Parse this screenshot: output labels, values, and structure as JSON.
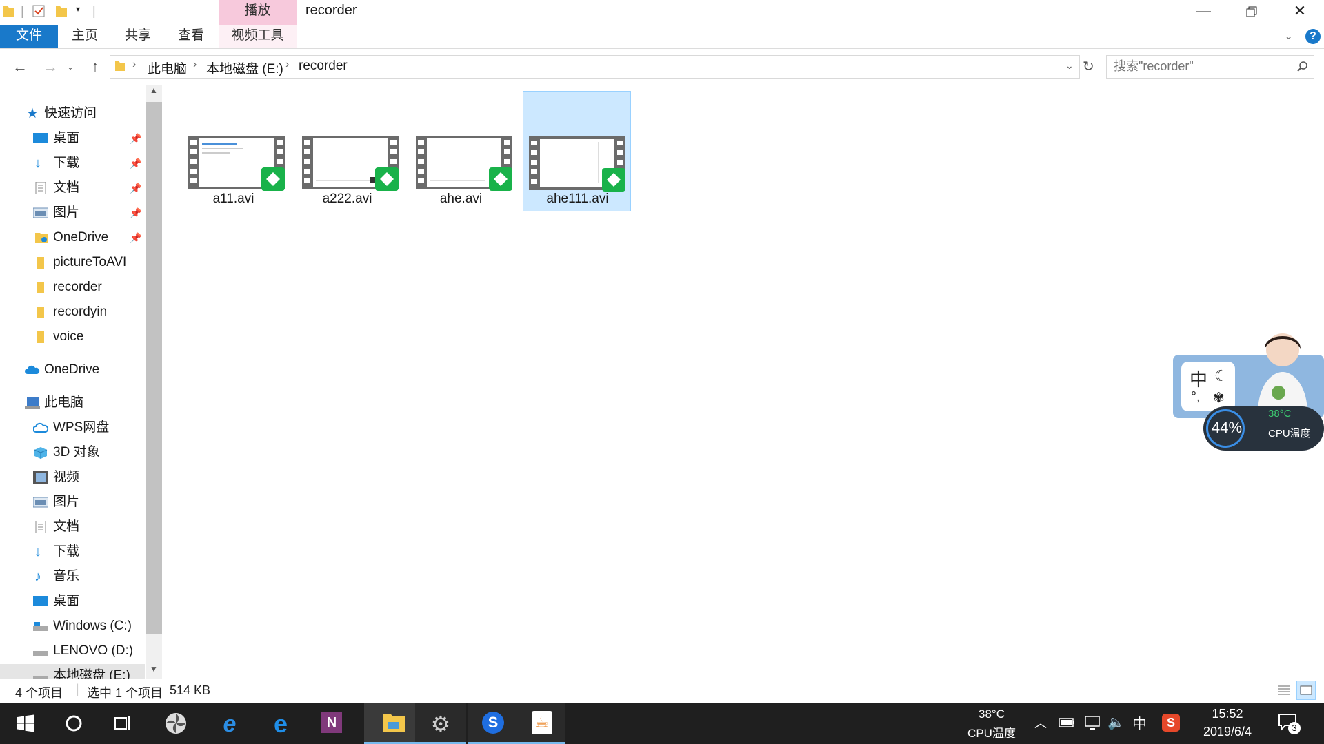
{
  "window": {
    "title": "recorder",
    "context_tab": "播放",
    "minimize_icon": "minimize-icon",
    "restore_icon": "restore-icon",
    "close_icon": "close-icon"
  },
  "ribbon": {
    "tabs": [
      {
        "label": "文件"
      },
      {
        "label": "主页"
      },
      {
        "label": "共享"
      },
      {
        "label": "查看"
      },
      {
        "label": "视频工具"
      }
    ]
  },
  "address": {
    "crumbs": [
      "此电脑",
      "本地磁盘 (E:)",
      "recorder"
    ],
    "search_placeholder": "搜索\"recorder\""
  },
  "sidebar": {
    "quick_access": "快速访问",
    "items": [
      {
        "label": "桌面",
        "icon": "desktop-icon",
        "pinned": true
      },
      {
        "label": "下载",
        "icon": "download-icon",
        "pinned": true
      },
      {
        "label": "文档",
        "icon": "document-icon",
        "pinned": true
      },
      {
        "label": "图片",
        "icon": "picture-icon",
        "pinned": true
      },
      {
        "label": "OneDrive",
        "icon": "folder-icon",
        "pinned": true
      },
      {
        "label": "pictureToAVI",
        "icon": "folder-icon",
        "pinned": false
      },
      {
        "label": "recorder",
        "icon": "folder-icon",
        "pinned": false
      },
      {
        "label": "recordyin",
        "icon": "folder-icon",
        "pinned": false
      },
      {
        "label": "voice",
        "icon": "folder-icon",
        "pinned": false
      }
    ],
    "onedrive": "OneDrive",
    "this_pc": "此电脑",
    "pc_items": [
      {
        "label": "WPS网盘",
        "icon": "cloud-icon"
      },
      {
        "label": "3D 对象",
        "icon": "3d-objects-icon"
      },
      {
        "label": "视频",
        "icon": "video-icon"
      },
      {
        "label": "图片",
        "icon": "picture-icon"
      },
      {
        "label": "文档",
        "icon": "document-icon"
      },
      {
        "label": "下载",
        "icon": "download-icon"
      },
      {
        "label": "音乐",
        "icon": "music-icon"
      },
      {
        "label": "桌面",
        "icon": "desktop-icon"
      },
      {
        "label": "Windows (C:)",
        "icon": "drive-icon"
      },
      {
        "label": "LENOVO (D:)",
        "icon": "drive-icon"
      },
      {
        "label": "本地磁盘 (E:)",
        "icon": "drive-icon"
      }
    ]
  },
  "files": [
    {
      "name": "a11.avi",
      "selected": false
    },
    {
      "name": "a222.avi",
      "selected": false
    },
    {
      "name": "ahe.avi",
      "selected": false
    },
    {
      "name": "ahe111.avi",
      "selected": true
    }
  ],
  "status": {
    "item_count": "4 个项目",
    "selection": "选中 1 个项目",
    "size": "514 KB"
  },
  "widget": {
    "ime_char": "中",
    "percent": "44%",
    "temp": "38°C",
    "label": "CPU温度"
  },
  "taskbar": {
    "cpu_temp": "38°C",
    "cpu_label": "CPU温度",
    "ime": "中",
    "time": "15:52",
    "date": "2019/6/4",
    "notifications": "3"
  },
  "colors": {
    "accent": "#1979ca",
    "selection": "#cce8ff",
    "context_tab": "#f7c9dc",
    "taskbar": "#1f1f1f"
  }
}
